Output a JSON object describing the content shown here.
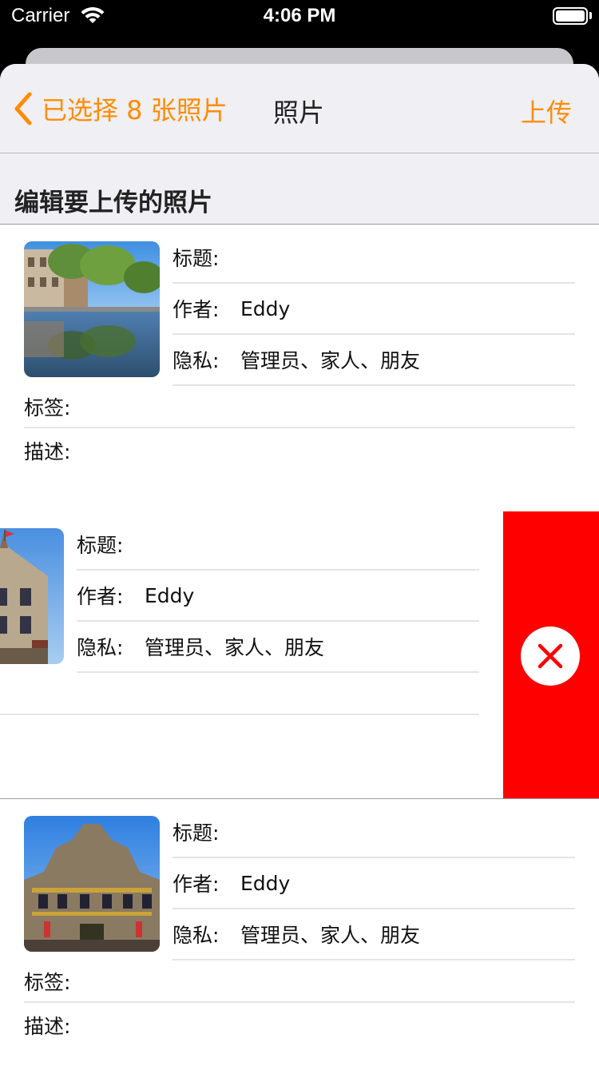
{
  "status_bar": {
    "carrier": "Carrier",
    "time": "4:06 PM"
  },
  "nav": {
    "back_label": "已选择 8 张照片",
    "title": "照片",
    "upload_label": "上传"
  },
  "section": {
    "title": "编辑要上传的照片"
  },
  "labels": {
    "title": "标题:",
    "author": "作者:",
    "privacy": "隐私:",
    "tags": "标签:",
    "description": "描述:"
  },
  "photos": [
    {
      "title": "",
      "author": "Eddy",
      "privacy": "管理员、家人、朋友",
      "tags": "",
      "description": ""
    },
    {
      "title": "",
      "author": "Eddy",
      "privacy": "管理员、家人、朋友",
      "tags": "",
      "description": ""
    },
    {
      "title": "",
      "author": "Eddy",
      "privacy": "管理员、家人、朋友",
      "tags": "",
      "description": ""
    }
  ],
  "colors": {
    "accent": "#ff8c00",
    "delete": "#ff0000",
    "header_bg": "#efeff4"
  },
  "icons": {
    "back": "chevron-left-icon",
    "delete": "close-icon",
    "wifi": "wifi-icon",
    "battery": "battery-icon"
  }
}
